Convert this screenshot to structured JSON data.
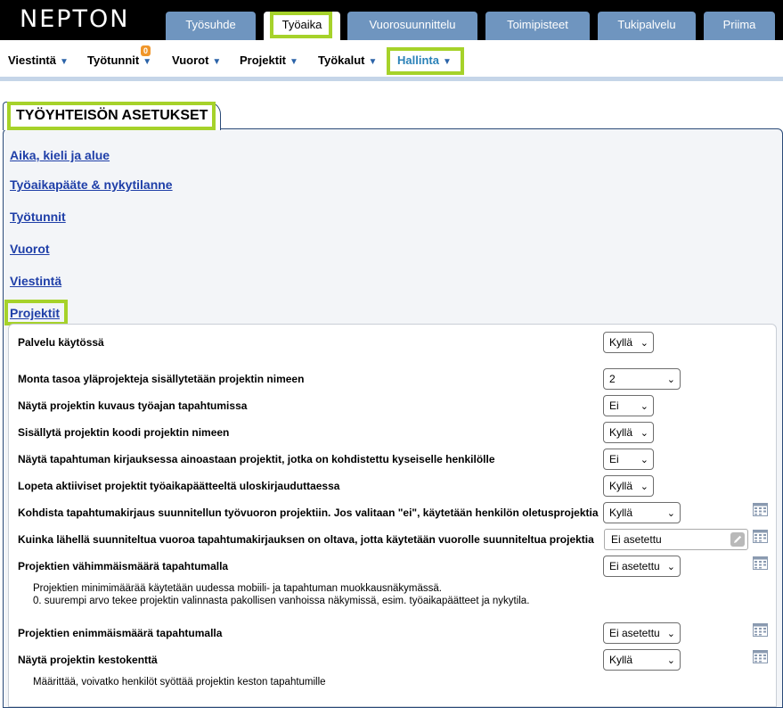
{
  "logo": "NEPTON",
  "main_tabs": [
    "Työsuhde",
    "Työaika",
    "Vuorosuunnittelu",
    "Toimipisteet",
    "Tukipalvelu",
    "Priima"
  ],
  "sub_nav": [
    "Viestintä",
    "Työtunnit",
    "Vuorot",
    "Projektit",
    "Työkalut",
    "Hallinta"
  ],
  "work_hours_badge": "0",
  "section_title": "TYÖYHTEISÖN ASETUKSET",
  "section_links": [
    "Aika, kieli ja alue",
    "Työaikapääte & nykytilanne",
    "Työtunnit",
    "Vuorot",
    "Viestintä",
    "Projektit"
  ],
  "colors": {
    "accent_highlight": "#a6d22a",
    "tab_blue": "#6f95bf",
    "link": "#1f3fa8"
  },
  "settings": [
    {
      "label": "Palvelu käytössä",
      "value": "Kyllä"
    },
    {
      "label": "Monta tasoa yläprojekteja sisällytetään projektin nimeen",
      "value": "2"
    },
    {
      "label": "Näytä projektin kuvaus työajan tapahtumissa",
      "value": "Ei"
    },
    {
      "label": "Sisällytä projektin koodi projektin nimeen",
      "value": "Kyllä"
    },
    {
      "label": "Näytä tapahtuman kirjauksessa ainoastaan projektit, jotka on kohdistettu kyseiselle henkilölle",
      "value": "Ei"
    },
    {
      "label": "Lopeta aktiiviset projektit työaikapäätteeltä uloskirjauduttaessa",
      "value": "Kyllä"
    },
    {
      "label": "Kohdista tapahtumakirjaus suunnitellun työvuoron projektiin. Jos valitaan \"ei\", käytetään henkilön oletusprojektia",
      "value": "Kyllä"
    },
    {
      "label": "Kuinka lähellä suunniteltua vuoroa tapahtumakirjauksen on oltava, jotta käytetään vuorolle suunniteltua projektia",
      "value": "Ei asetettu"
    },
    {
      "label": "Projektien vähimmäismäärä tapahtumalla",
      "value": "Ei asetettu",
      "description": [
        "Projektien minimimäärää käytetään uudessa mobiili- ja tapahtuman muokkausnäkymässä.",
        "0. suurempi arvo tekee projektin valinnasta pakollisen vanhoissa näkymissä, esim. työaikapäätteet ja nykytila."
      ]
    },
    {
      "label": "Projektien enimmäismäärä tapahtumalla",
      "value": "Ei asetettu"
    },
    {
      "label": "Näytä projektin kestokenttä",
      "value": "Kyllä",
      "description": [
        "Määrittää, voivatko henkilöt syöttää projektin keston tapahtumille"
      ]
    }
  ]
}
